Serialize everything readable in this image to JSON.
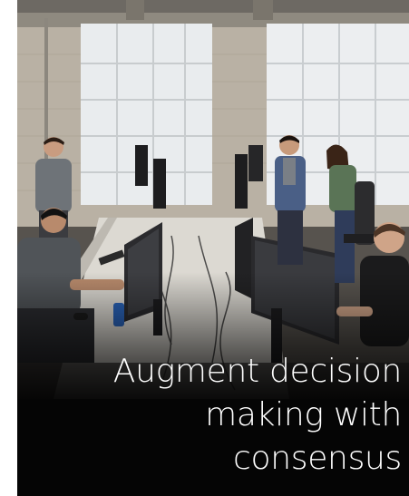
{
  "tile": {
    "headline_lines": [
      "Augment decision",
      "making with",
      "consensus"
    ],
    "colors": {
      "text": "#ffffff",
      "background": "#050505"
    }
  }
}
